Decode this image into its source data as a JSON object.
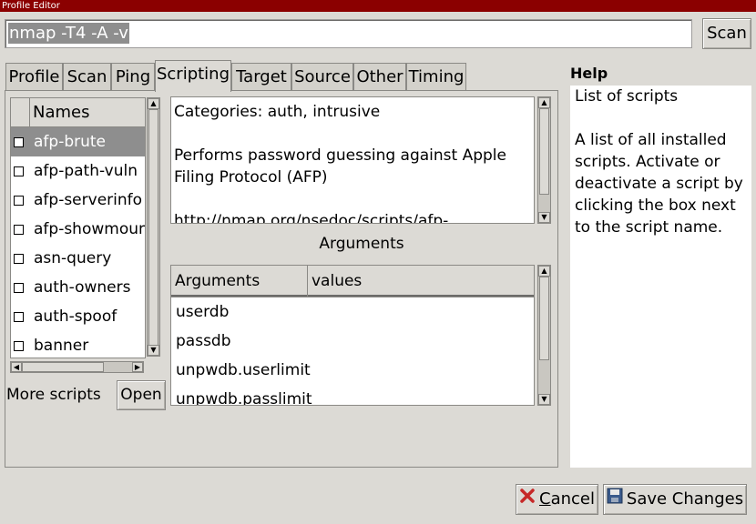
{
  "window": {
    "title": "Profile Editor"
  },
  "command": {
    "value": "nmap -T4 -A -v",
    "scan_label": "Scan"
  },
  "tabs": [
    {
      "label": "Profile"
    },
    {
      "label": "Scan"
    },
    {
      "label": "Ping"
    },
    {
      "label": "Scripting",
      "active": true
    },
    {
      "label": "Target"
    },
    {
      "label": "Source"
    },
    {
      "label": "Other"
    },
    {
      "label": "Timing"
    }
  ],
  "scripts": {
    "header": "Names",
    "items": [
      {
        "name": "afp-brute",
        "checked": false,
        "selected": true
      },
      {
        "name": "afp-path-vuln",
        "checked": false
      },
      {
        "name": "afp-serverinfo",
        "checked": false
      },
      {
        "name": "afp-showmount",
        "checked": false
      },
      {
        "name": "asn-query",
        "checked": false
      },
      {
        "name": "auth-owners",
        "checked": false
      },
      {
        "name": "auth-spoof",
        "checked": false
      },
      {
        "name": "banner",
        "checked": false
      }
    ],
    "more_label": "More scripts",
    "open_label": "Open"
  },
  "description": {
    "categories": "Categories: auth, intrusive",
    "text": "Performs password guessing against Apple Filing Protocol (AFP)",
    "url": "http://nmap.org/nsedoc/scripts/afp-"
  },
  "arguments": {
    "title": "Arguments",
    "columns": [
      "Arguments",
      "values"
    ],
    "rows": [
      "userdb",
      "passdb",
      "unpwdb.userlimit",
      "unpwdb.passlimit"
    ]
  },
  "help": {
    "title": "Help",
    "heading": "List of scripts",
    "body": "A list of all installed scripts. Activate or deactivate a script by clicking the box next to the script name."
  },
  "buttons": {
    "cancel_first": "C",
    "cancel_rest": "ancel",
    "save": "Save Changes"
  }
}
